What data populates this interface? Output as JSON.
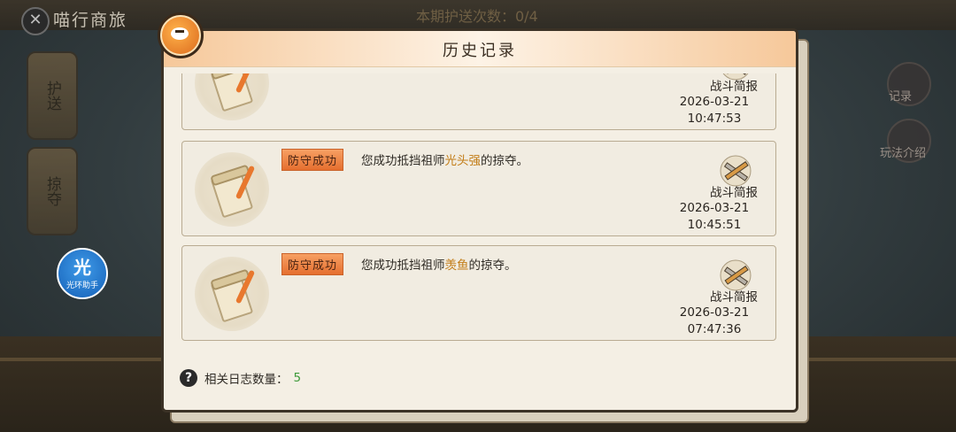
{
  "background": {
    "game_title": "喵行商旅",
    "escort_count_text": "本期护送次数：0/4",
    "left_tabs": [
      {
        "label": "护送"
      },
      {
        "label": "掠夺"
      }
    ],
    "helper": {
      "glyph": "光",
      "label": "光环助手"
    },
    "right_buttons": [
      {
        "label": "记录"
      },
      {
        "label": "玩法介绍"
      }
    ]
  },
  "modal": {
    "title": "历史记录",
    "records": [
      {
        "tag": "",
        "message_prefix": "",
        "name": "",
        "message_suffix": "",
        "battle_label": "战斗简报",
        "date": "2026-03-21",
        "time": "10:47:53"
      },
      {
        "tag": "防守成功",
        "message_prefix": "您成功抵挡祖师",
        "name": "光头强",
        "message_suffix": "的掠夺。",
        "battle_label": "战斗简报",
        "date": "2026-03-21",
        "time": "10:45:51"
      },
      {
        "tag": "防守成功",
        "message_prefix": "您成功抵挡祖师",
        "name": "羡鱼",
        "message_suffix": "的掠夺。",
        "battle_label": "战斗简报",
        "date": "2026-03-21",
        "time": "07:47:36"
      }
    ],
    "footer": {
      "help_glyph": "?",
      "label": "相关日志数量：",
      "count": "5"
    }
  },
  "colors": {
    "tag_bg": "#e56f2f",
    "name_highlight": "#c27c16",
    "count_green": "#3e9a3a"
  }
}
